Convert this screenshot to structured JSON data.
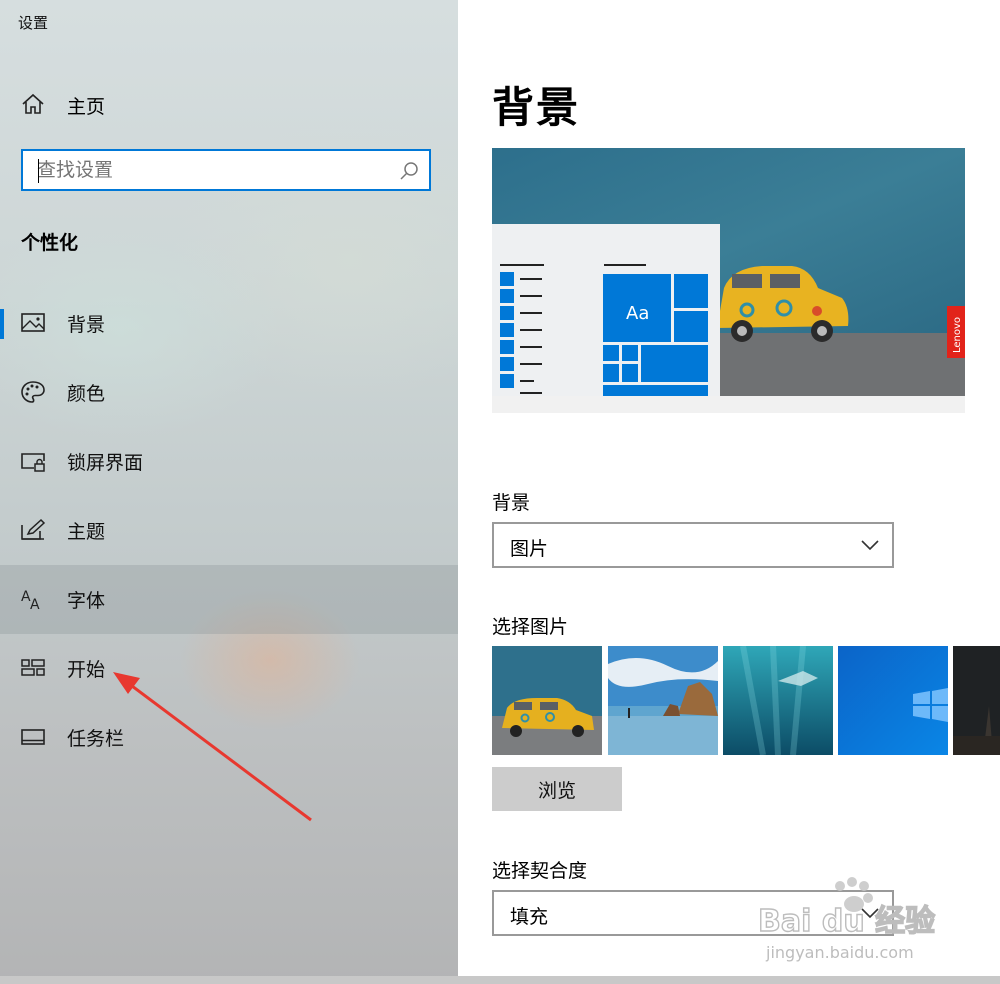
{
  "window": {
    "title": "设置"
  },
  "sidebar": {
    "home_label": "主页",
    "search": {
      "placeholder": "查找设置"
    },
    "section_title": "个性化",
    "items": [
      {
        "label": "背景",
        "icon": "picture-icon"
      },
      {
        "label": "颜色",
        "icon": "palette-icon"
      },
      {
        "label": "锁屏界面",
        "icon": "lock-screen-icon"
      },
      {
        "label": "主题",
        "icon": "theme-icon"
      },
      {
        "label": "字体",
        "icon": "font-icon"
      },
      {
        "label": "开始",
        "icon": "start-icon"
      },
      {
        "label": "任务栏",
        "icon": "taskbar-icon"
      }
    ],
    "selected_index": 0,
    "hover_index": 4
  },
  "main": {
    "title": "背景",
    "preview": {
      "sample_text": "Aa",
      "brand_tag": "Lenovo"
    },
    "background_label": "背景",
    "background_value": "图片",
    "choose_picture_label": "选择图片",
    "browse_label": "浏览",
    "fit_label": "选择契合度",
    "fit_value": "填充"
  },
  "watermark": {
    "text": "Bai du 经验",
    "url": "jingyan.baidu.com"
  },
  "colors": {
    "accent": "#0078d7",
    "arrow": "#e8382f",
    "lenovo": "#e2231a"
  }
}
